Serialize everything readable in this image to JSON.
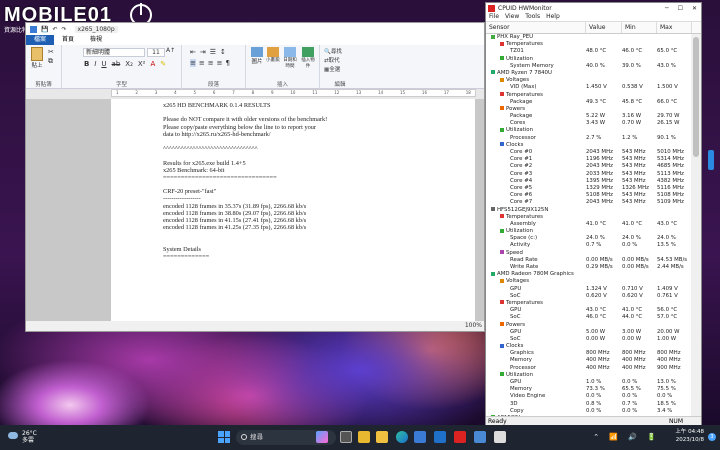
{
  "watermark": {
    "brand": "MOBILE01",
    "sub": "資源比特群"
  },
  "wordpad": {
    "title": "x265_1080p",
    "tabs": [
      "檔案",
      "首頁",
      "檢視"
    ],
    "ribbon": {
      "clipboard": {
        "label": "剪貼簿",
        "paste": "貼上"
      },
      "font": {
        "label": "字型",
        "font_name": "新細明體",
        "font_size": "11"
      },
      "paragraph": {
        "label": "段落"
      },
      "insert": {
        "label": "插入",
        "picture": "圖片",
        "paint": "小畫家繪圖",
        "datetime": "日期和時間",
        "object": "插入物件"
      },
      "edit": {
        "label": "編輯",
        "find": "尋找",
        "replace": "取代",
        "select_all": "全選"
      }
    },
    "document_lines": [
      "x265 HD BENCHMARK 0.1.4 RESULTS",
      "",
      "Please do NOT compare it with older versions of the benchmark!",
      "Please copy/paste everything below the line to to report your",
      "data to http://x265.ru/x265-hd-benchmark/",
      "",
      "^^^^^^^^^^^^^^^^^^^^^^^^^^^^^^^^",
      "",
      "Results for x265.exe build 1.4+5",
      "x265 Benchmark: 64-bit",
      "================================",
      "",
      "CRF-20 preset-\"fast\"",
      "------------------",
      "encoded 1128 frames in 35.37s (31.89 fps), 2266.68 kb/s",
      "encoded 1128 frames in 38.80s (29.07 fps), 2266.68 kb/s",
      "encoded 1128 frames in 41.15s (27.41 fps), 2266.68 kb/s",
      "encoded 1128 frames in 41.25s (27.35 fps), 2266.68 kb/s",
      "",
      "",
      "System Details",
      "============="
    ],
    "zoom": "100%"
  },
  "hwmonitor": {
    "title": "CPUID HWMonitor",
    "menu": [
      "File",
      "View",
      "Tools",
      "Help"
    ],
    "columns": [
      "Sensor",
      "Value",
      "Min",
      "Max"
    ],
    "rows": [
      [
        "PHX Ray_PEU",
        "",
        "",
        "",
        1,
        "mb"
      ],
      [
        "Temperatures",
        "",
        "",
        "",
        2,
        "t"
      ],
      [
        "TZ01",
        "48.0 °C",
        "46.0 °C",
        "65.0 °C",
        3,
        "v"
      ],
      [
        "Utilization",
        "",
        "",
        "",
        2,
        "u"
      ],
      [
        "System Memory",
        "40.0 %",
        "39.0 %",
        "43.0 %",
        3,
        "v"
      ],
      [
        "AMD Ryzen 7 7840U",
        "",
        "",
        "",
        1,
        "cpu"
      ],
      [
        "Voltages",
        "",
        "",
        "",
        2,
        "vo"
      ],
      [
        "VID (Max)",
        "1.450 V",
        "0.538 V",
        "1.500 V",
        3,
        "v"
      ],
      [
        "Temperatures",
        "",
        "",
        "",
        2,
        "t"
      ],
      [
        "Package",
        "49.3 °C",
        "45.8 °C",
        "66.0 °C",
        3,
        "v"
      ],
      [
        "Powers",
        "",
        "",
        "",
        2,
        "p"
      ],
      [
        "Package",
        "5.22 W",
        "3.16 W",
        "29.70 W",
        3,
        "v"
      ],
      [
        "Cores",
        "3.43 W",
        "0.70 W",
        "26.15 W",
        3,
        "v"
      ],
      [
        "Utilization",
        "",
        "",
        "",
        2,
        "u"
      ],
      [
        "Processor",
        "2.7 %",
        "1.2 %",
        "90.1 %",
        3,
        "v"
      ],
      [
        "Clocks",
        "",
        "",
        "",
        2,
        "c"
      ],
      [
        "Core #0",
        "2043 MHz",
        "543 MHz",
        "5010 MHz",
        3,
        "v"
      ],
      [
        "Core #1",
        "1196 MHz",
        "543 MHz",
        "5314 MHz",
        3,
        "v"
      ],
      [
        "Core #2",
        "2043 MHz",
        "543 MHz",
        "4685 MHz",
        3,
        "v"
      ],
      [
        "Core #3",
        "2033 MHz",
        "543 MHz",
        "5113 MHz",
        3,
        "v"
      ],
      [
        "Core #4",
        "1395 MHz",
        "543 MHz",
        "4382 MHz",
        3,
        "v"
      ],
      [
        "Core #5",
        "1329 MHz",
        "1326 MHz",
        "5116 MHz",
        3,
        "v"
      ],
      [
        "Core #6",
        "5108 MHz",
        "543 MHz",
        "5108 MHz",
        3,
        "v"
      ],
      [
        "Core #7",
        "2043 MHz",
        "543 MHz",
        "5109 MHz",
        3,
        "v"
      ],
      [
        "HFS512GEJ9X125N",
        "",
        "",
        "",
        1,
        "hd"
      ],
      [
        "Temperatures",
        "",
        "",
        "",
        2,
        "t"
      ],
      [
        "Assembly",
        "41.0 °C",
        "41.0 °C",
        "43.0 °C",
        3,
        "v"
      ],
      [
        "Utilization",
        "",
        "",
        "",
        2,
        "u"
      ],
      [
        "Space (c:)",
        "24.0 %",
        "24.0 %",
        "24.0 %",
        3,
        "v"
      ],
      [
        "Activity",
        "0.7 %",
        "0.0 %",
        "13.5 %",
        3,
        "v"
      ],
      [
        "Speed",
        "",
        "",
        "",
        2,
        "s"
      ],
      [
        "Read Rate",
        "0.00 MB/s",
        "0.00 MB/s",
        "54.53 MB/s",
        3,
        "v"
      ],
      [
        "Write Rate",
        "0.29 MB/s",
        "0.00 MB/s",
        "2.44 MB/s",
        3,
        "v"
      ],
      [
        "AMD Radeon 780M Graphics",
        "",
        "",
        "",
        1,
        "gpu"
      ],
      [
        "Voltages",
        "",
        "",
        "",
        2,
        "vo"
      ],
      [
        "GPU",
        "1.324 V",
        "0.710 V",
        "1.409 V",
        3,
        "v"
      ],
      [
        "SoC",
        "0.620 V",
        "0.620 V",
        "0.761 V",
        3,
        "v"
      ],
      [
        "Temperatures",
        "",
        "",
        "",
        2,
        "t"
      ],
      [
        "GPU",
        "43.0 °C",
        "41.0 °C",
        "56.0 °C",
        3,
        "v"
      ],
      [
        "SoC",
        "46.0 °C",
        "44.0 °C",
        "57.0 °C",
        3,
        "v"
      ],
      [
        "Powers",
        "",
        "",
        "",
        2,
        "p"
      ],
      [
        "GPU",
        "5.00 W",
        "3.00 W",
        "20.00 W",
        3,
        "v"
      ],
      [
        "SoC",
        "0.00 W",
        "0.00 W",
        "1.00 W",
        3,
        "v"
      ],
      [
        "Clocks",
        "",
        "",
        "",
        2,
        "c"
      ],
      [
        "Graphics",
        "800 MHz",
        "800 MHz",
        "800 MHz",
        3,
        "v"
      ],
      [
        "Memory",
        "400 MHz",
        "400 MHz",
        "400 MHz",
        3,
        "v"
      ],
      [
        "Processor",
        "400 MHz",
        "400 MHz",
        "900 MHz",
        3,
        "v"
      ],
      [
        "Utilization",
        "",
        "",
        "",
        2,
        "u"
      ],
      [
        "GPU",
        "1.0 %",
        "0.0 %",
        "13.0 %",
        3,
        "v"
      ],
      [
        "Memory",
        "73.3 %",
        "65.5 %",
        "75.5 %",
        3,
        "v"
      ],
      [
        "Video Engine",
        "0.0 %",
        "0.0 %",
        "0.0 %",
        3,
        "v"
      ],
      [
        "3D",
        "0.8 %",
        "0.7 %",
        "18.5 %",
        3,
        "v"
      ],
      [
        "Copy",
        "0.0 %",
        "0.0 %",
        "3.4 %",
        3,
        "v"
      ],
      [
        "AP15O5L",
        "",
        "",
        "",
        1,
        "bat"
      ],
      [
        "Voltages",
        "",
        "",
        "",
        2,
        "vo"
      ]
    ],
    "status_left": "Ready",
    "status_right": "NUM"
  },
  "taskbar": {
    "weather_temp": "26°C",
    "weather_desc": "多雲",
    "search_placeholder": "搜尋",
    "time": "上午 04:48",
    "date": "2023/10/8",
    "notification_count": "3"
  }
}
